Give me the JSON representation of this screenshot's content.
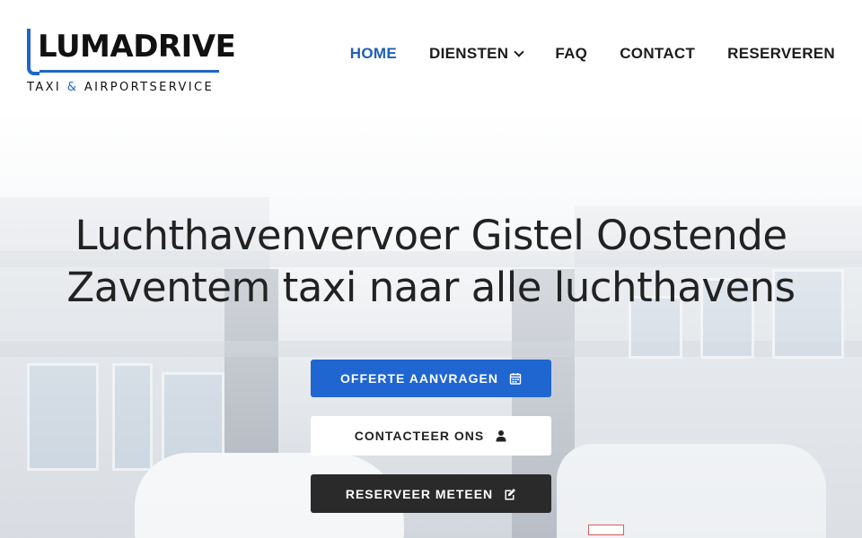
{
  "brand": {
    "name": "LUMADRIVE",
    "tagline_part1": "TAXI",
    "tagline_amp": "&",
    "tagline_part2": "AIRPORTSERVICE",
    "color": "#1f66c9"
  },
  "nav": {
    "items": [
      {
        "label": "HOME",
        "active": true
      },
      {
        "label": "DIENSTEN",
        "has_dropdown": true
      },
      {
        "label": "FAQ"
      },
      {
        "label": "CONTACT"
      },
      {
        "label": "RESERVEREN"
      }
    ],
    "active_color": "#1f5fb5"
  },
  "hero": {
    "title_line1": "Luchthavenvervoer Gistel Oostende",
    "title_line2": "Zaventem taxi naar alle luchthavens",
    "buttons": {
      "quote": {
        "label": "OFFERTE AANVRAGEN",
        "icon": "calendar-icon",
        "color": "#1f66d1"
      },
      "contact": {
        "label": "CONTACTEER ONS",
        "icon": "user-icon",
        "color": "#ffffff"
      },
      "book": {
        "label": "RESERVEER METEEN",
        "icon": "edit-icon",
        "color": "#2a2a2a"
      }
    }
  }
}
